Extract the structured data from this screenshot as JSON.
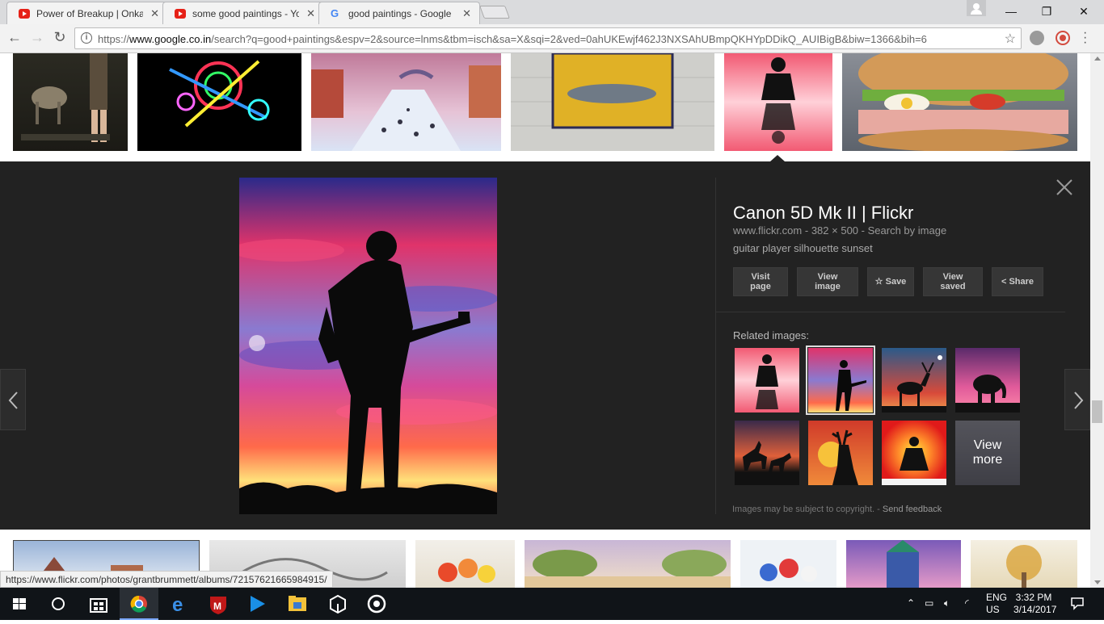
{
  "browser": {
    "tabs": [
      {
        "title": "Power of Breakup | Onka",
        "favicon": "youtube-icon"
      },
      {
        "title": "some good paintings - Yo",
        "favicon": "youtube-icon"
      },
      {
        "title": "good paintings - Google",
        "favicon": "google-icon",
        "active": true
      }
    ],
    "url_prefix": "https://",
    "url_host": "www.google.co.in",
    "url_rest": "/search?q=good+paintings&espv=2&source=lnms&tbm=isch&sa=X&sqi=2&ved=0ahUKEwjf462J3NXSAhUBmpQKHYpDDikQ_AUIBigB&biw=1366&bih=6",
    "window_controls": {
      "minimize": "—",
      "restore": "❐",
      "close": "✕"
    }
  },
  "preview": {
    "title": "Canon 5D Mk II | Flickr",
    "site": "www.flickr.com",
    "dimensions": "382 × 500",
    "search_by_image": "Search by image",
    "separator": "-",
    "description": "guitar player silhouette sunset",
    "buttons": {
      "visit_page": [
        "Visit",
        "page"
      ],
      "view_image": [
        "View",
        "image"
      ],
      "save": "Save",
      "view_saved": [
        "View",
        "saved"
      ],
      "share": "Share"
    },
    "related_label": "Related images:",
    "view_more": [
      "View",
      "more"
    ],
    "copyright": "Images may be subject to copyright.",
    "feedback_sep": "-",
    "send_feedback": "Send feedback"
  },
  "status_url": "https://www.flickr.com/photos/grantbrummett/albums/72157621665984915/",
  "taskbar": {
    "language": [
      "ENG",
      "US"
    ],
    "time": "3:32 PM",
    "date": "3/14/2017"
  },
  "colors": {
    "panel_bg": "#222222",
    "taskbar_bg": "#101418",
    "youtube_red": "#e62117"
  }
}
